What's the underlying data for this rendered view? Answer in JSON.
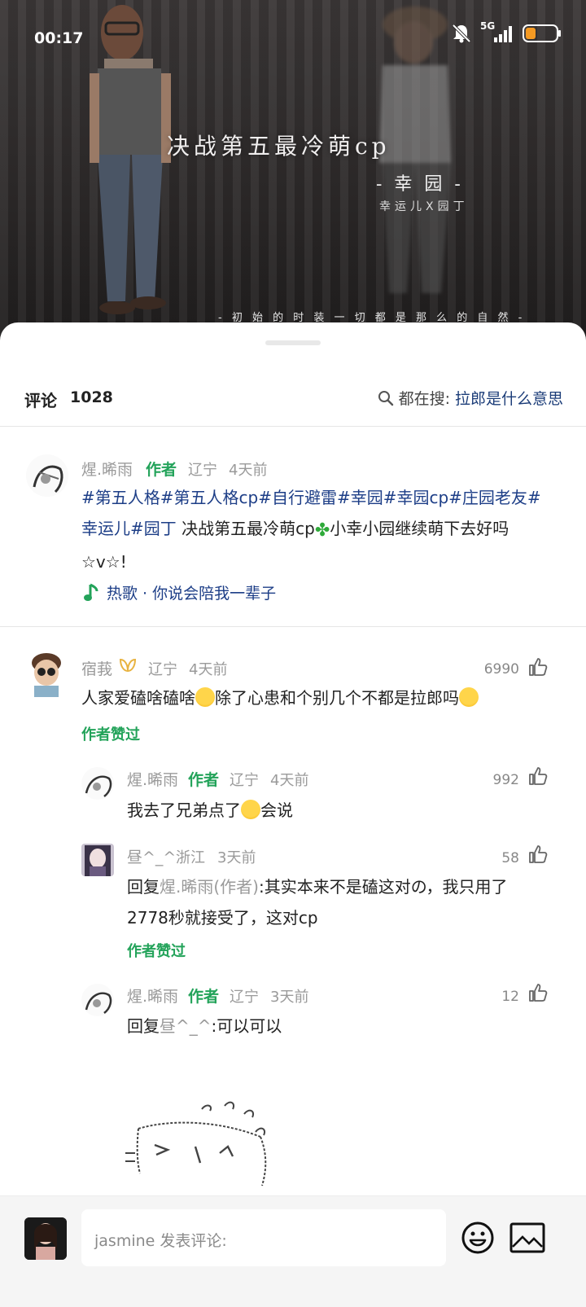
{
  "status_bar": {
    "time": "00:17",
    "network": "5G",
    "battery_percent": 25
  },
  "video": {
    "title": "决战第五最冷萌cp",
    "subtitle": "- 幸 园 -",
    "subtitle2": "幸运儿X园丁",
    "caption": "- 初 始 的 时 装   一 切 都 是 那 么 的 自 然 -"
  },
  "comments_header": {
    "title": "评论",
    "count": "1028",
    "search_prefix": "都在搜:",
    "search_term": "拉郎是什么意思"
  },
  "post": {
    "user": "煋.晞雨",
    "author_tag": "作者",
    "location": "辽宁",
    "time": "4天前",
    "hashtags_line1": "#第五人格#第五人格cp#自行避雷#幸园#幸园cp#庄园老友#",
    "hashtags_line2_tag": "幸运儿#园丁",
    "text_line2": " 决战第五最冷萌cp",
    "text_line2_tail": "小幸小园继续萌下去好吗",
    "text_line3": "☆v☆!",
    "music": "热歌 · 你说会陪我一辈子"
  },
  "comments": [
    {
      "user": "宿莪",
      "location": "辽宁",
      "time": "4天前",
      "likes": "6990",
      "text_a": "人家爱磕啥磕啥",
      "text_b": "除了心患和个别几个不都是拉郎吗",
      "liked_by_author": "作者赞过"
    },
    {
      "user": "煋.晞雨",
      "author_tag": "作者",
      "location": "辽宁",
      "time": "4天前",
      "likes": "992",
      "text_a": "我去了兄弟点了",
      "text_b": "会说"
    },
    {
      "user": "昼^_^",
      "location": "浙江",
      "time": "3天前",
      "likes": "58",
      "reply_prefix": "回复",
      "reply_to": "煋.晞雨(作者)",
      "text_line1": ":其实本来不是磕这对の，我只用了",
      "text_line2": "2778秒就接受了，这对cp",
      "liked_by_author": "作者赞过"
    },
    {
      "user": "煋.晞雨",
      "author_tag": "作者",
      "location": "辽宁",
      "time": "3天前",
      "likes": "12",
      "reply_prefix": "回复",
      "reply_to": "昼^_^",
      "text": ":可以可以"
    }
  ],
  "input": {
    "placeholder": "jasmine 发表评论:"
  },
  "icons": {
    "search": "search-icon",
    "like": "thumbs-up-icon",
    "music": "music-note-icon",
    "emoji": "smiley-icon",
    "image": "image-icon"
  },
  "colors": {
    "author_green": "#23a35a",
    "link_blue": "#1d3e87",
    "battery_orange": "#f59a23"
  }
}
